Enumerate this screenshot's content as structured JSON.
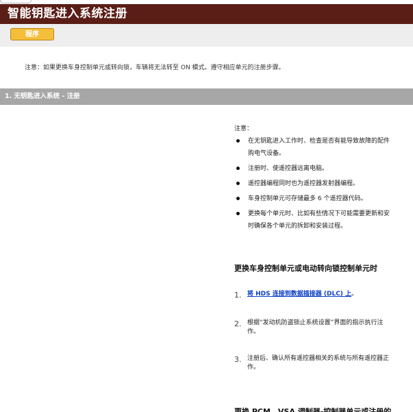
{
  "header": {
    "title": "智能钥匙进入系统注册",
    "procedure_button": "程序"
  },
  "intro_note": "注意：如果更换车身控制单元或转向锁，车辆将无法转至 ON 模式。遵守相应单元的注册步骤。",
  "section": {
    "title": "1. 无钥匙进入系统 - 注册",
    "note_label": "注意：",
    "bullets": [
      {
        "line1": "在无钥匙进入工作时、检查是否有能导致故障的配件",
        "line2": "购电气设备。"
      },
      {
        "line1": "注册时、使遥控器远离电脑。",
        "line2": ""
      },
      {
        "line1": "遥控器编程同时也为遥控器发射器编程。",
        "line2": ""
      },
      {
        "line1": "车身控制单元可存储最多 6 个遥控器代码。",
        "line2": ""
      },
      {
        "line1": "更换每个单元时、比如有些情况下可能需要更新和安",
        "line2": "时确保各个单元的拆卸和安装过程。"
      }
    ],
    "subheading": "更换车身控制单元或电动转向锁控制单元时",
    "steps": [
      {
        "num": "1.",
        "link": "将 HDS 连接到数据插接器 (DLC) 上",
        "tail": "。",
        "line2": ""
      },
      {
        "num": "2.",
        "link": "",
        "tail": "根据“发动机防盗锁止系统设置”界面的指示执行注",
        "line2": "作。"
      },
      {
        "num": "3.",
        "link": "",
        "tail": "注册后、确认所有遥控器相关的系统与所有遥控器正",
        "line2": "作。"
      }
    ],
    "bottom_heading": "更换 PCM、VSA 调制器-控制器单元或注册的"
  }
}
